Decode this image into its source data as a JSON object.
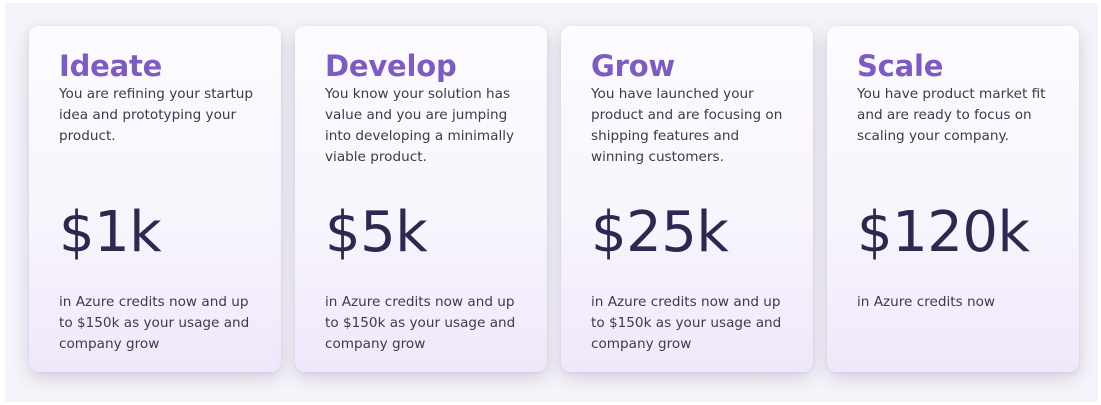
{
  "colors": {
    "title_accent": "#7e5bc2",
    "amount_text": "#2f2750",
    "body_text": "#3d3a4a",
    "card_bottom_tint": "#efe7fb"
  },
  "tiers": [
    {
      "title": "Ideate",
      "description": "You are refining your startup idea and prototyping your product.",
      "amount": "$1k",
      "credits": "in Azure credits now and up to $150k as your usage and company grow"
    },
    {
      "title": "Develop",
      "description": "You know your solution has value and you are jumping into developing a minimally viable product.",
      "amount": "$5k",
      "credits": "in Azure credits now and up to $150k as your usage and company grow"
    },
    {
      "title": "Grow",
      "description": "You have launched your product and are focusing on shipping features and winning customers.",
      "amount": "$25k",
      "credits": "in Azure credits now and up to $150k as your usage and company grow"
    },
    {
      "title": "Scale",
      "description": "You have product market fit and are ready to focus on scaling your company.",
      "amount": "$120k",
      "credits": "in Azure credits now"
    }
  ]
}
